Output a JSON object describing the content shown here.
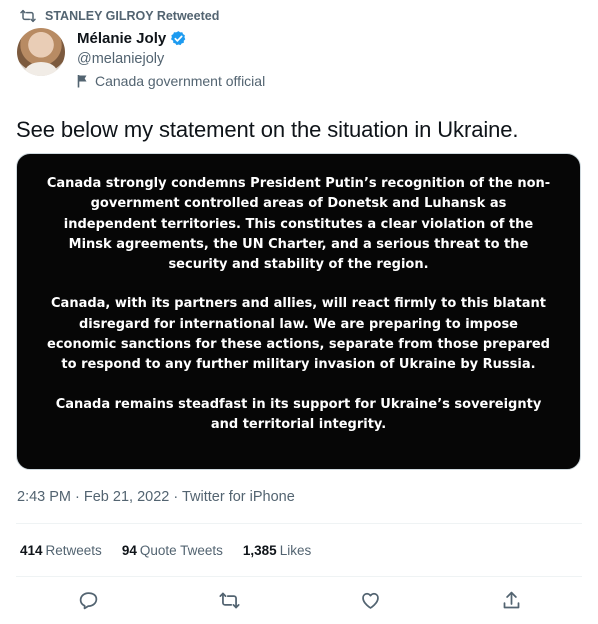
{
  "retweet": {
    "text": "STANLEY GILROY Retweeted",
    "icon": "retweet-icon"
  },
  "author": {
    "name": "Mélanie Joly",
    "handle": "@melaniejoly",
    "label": "Canada government official",
    "verified": true
  },
  "tweet": {
    "text": "See below my statement on the situation in Ukraine.",
    "statement_paragraphs": [
      "Canada strongly condemns President Putin’s recognition of the non-government controlled areas of Donetsk and Luhansk as independent territories. This constitutes a clear violation of the Minsk agreements, the UN Charter, and a serious threat to the security and stability of the region.",
      "Canada, with its partners and allies, will react firmly to this blatant disregard for international law. We are preparing to impose economic sanctions for these actions, separate from those prepared to respond to any further military invasion of Ukraine by Russia.",
      "Canada remains steadfast in its support for Ukraine’s sovereignty and territorial integrity."
    ],
    "meta": "2:43 PM · Feb 21, 2022 · Twitter for iPhone"
  },
  "stats": {
    "retweets_count": "414",
    "retweets_label": "Retweets",
    "quotes_count": "94",
    "quotes_label": "Quote Tweets",
    "likes_count": "1,385",
    "likes_label": "Likes"
  },
  "colors": {
    "text": "#0f1419",
    "secondary": "#536471",
    "verified": "#1d9bf0",
    "image_bg": "#060606"
  }
}
